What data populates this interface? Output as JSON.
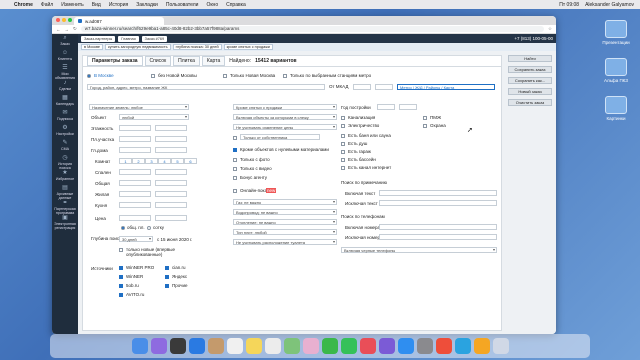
{
  "menubar": {
    "app": "Chrome",
    "items": [
      "Файл",
      "Изменить",
      "Вид",
      "История",
      "Закладки",
      "Пользователи",
      "Окно",
      "Справка"
    ],
    "clock": "Пт 09:08",
    "user": "Aleksander Galyamov"
  },
  "desktop_icons": [
    "Презентации",
    "Альфа ПКЗ",
    "Картинки"
  ],
  "browser": {
    "tab_title": "w.ad087",
    "url": "w7.baza-winner.ru/search/f629e9ba1-a85c-40d8-82b2-3bb7a57f988a/params"
  },
  "sidebar": [
    {
      "icon": "search-icon",
      "label": "Заказ"
    },
    {
      "icon": "users-icon",
      "label": "Клиенты"
    },
    {
      "icon": "list-icon",
      "label": "Мои объявления"
    },
    {
      "icon": "bell-icon",
      "label": "Сделки"
    },
    {
      "icon": "calendar-icon",
      "label": "Календарь"
    },
    {
      "icon": "mail-icon",
      "label": "Подписка"
    },
    {
      "icon": "gear-icon",
      "label": "Настройки"
    },
    {
      "icon": "chat-icon",
      "label": "СМА"
    },
    {
      "icon": "clock-icon",
      "label": "История поиска"
    },
    {
      "icon": "star-icon",
      "label": "Избранное"
    },
    {
      "icon": "archive-icon",
      "label": "Архивные данные"
    },
    {
      "icon": "handshake-icon",
      "label": "Партнерская программа"
    },
    {
      "icon": "doc-icon",
      "label": "Электронная регистрация"
    }
  ],
  "topbar": {
    "chips": [
      "Заказ-партнеры",
      "Главная",
      "Заказ #769"
    ],
    "phone": "+7 (813) 100-05-00"
  },
  "subbar": {
    "chips": [
      "в Москве",
      "купить загородную недвижимость",
      "глубина поиска: 30 дней",
      "кроме снятых с продажи"
    ]
  },
  "tabs": [
    "Параметры заказа",
    "Список",
    "Плитка",
    "Карта"
  ],
  "results": {
    "label": "Найдено:",
    "count": "15412 вариантов"
  },
  "location": {
    "city": "В Москве",
    "no_new_moscow": "без Новой Москвы",
    "only_new_moscow": "Только Новая Москва",
    "metro_only": "Только по выбранным станциям метро",
    "address_placeholder": "Город, район, адрес, метро, название ЖК",
    "from_mkad": "От МКАД",
    "metro_links": "Метро / Ж/Д / Районы / Карта"
  },
  "left_fields": {
    "land_purpose": "Назначение земель: любое",
    "object_label": "Объект",
    "object_value": "любой",
    "floors": "Этажность",
    "plot_area": "Пл.участка",
    "built_year": "Гл.дома",
    "rooms_label": "Комнат",
    "rooms": [
      "1",
      "2",
      "3",
      "4",
      "5",
      "6"
    ],
    "bedrooms": "Спален",
    "total": "Общая",
    "living": "Жилая",
    "kitchen": "Кухня",
    "price": "Цена",
    "price_total": "общ. пл.",
    "price_sqm": "сотку",
    "depth_label": "Глубина поиска",
    "depth_value": "30 дней",
    "depth_date": "с 15 июня 2020 г.",
    "new_only": "только новые (впервые опубликованные)",
    "sources_label": "Источники",
    "sources_left": [
      "WinNER PRO",
      "WinNER",
      "5ob.ru",
      "AVITO.ru"
    ],
    "sources_right": [
      "cian.ru",
      "Яндекс",
      "Прочие"
    ]
  },
  "mid_fields": {
    "removed": "Кроме снятых с продажи",
    "agreed": "Включая объекты за которыми в слежу",
    "price_change": "Не учитывать изменение цены",
    "owner_only": "Только от собственника",
    "zero_price": "Кроме объектов с нулевыми материалами",
    "with_photo": "Только с фото",
    "with_video": "Только с видео",
    "agent_bonus": "Бонус агенту",
    "online": "Онлайн-показ",
    "online_new": "new",
    "gas": "Газ: не важно",
    "water": "Водопровод: не важно",
    "heating": "Отопление: не важно",
    "plate": "Тип плит: любой",
    "toilet": "Не учитывать расположение туалета"
  },
  "right_fields": {
    "built_from": "Год постройки",
    "sewer": "Канализация",
    "pmzh": "ПМЖ",
    "electricity": "Электричество",
    "security": "Охрана",
    "bath": "Есть баня или сауна",
    "shower": "Есть душ",
    "garage": "Есть гараж",
    "pool": "Есть бассейн",
    "internet": "Есть канал интернет",
    "note_label": "Поиск по примечанию",
    "include_text": "Включая текст",
    "exclude_text": "Исключая текст",
    "phones_label": "Поиск по телефонам",
    "include_phones": "Включая номера",
    "exclude_phones": "Исключая номера",
    "black_phones": "Включая черные телефоны"
  },
  "actions": [
    "Найти",
    "Сохранить заказ",
    "Сохранить как...",
    "Новый заказ",
    "Очистить заказ"
  ],
  "colors": {
    "accent": "#1f6fc4",
    "sidebar": "#1f2d3d"
  }
}
